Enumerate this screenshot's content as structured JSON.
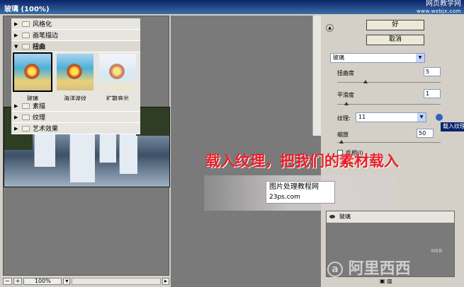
{
  "window": {
    "title": "玻璃  (100%)"
  },
  "watermark": {
    "site_name": "网页教学网",
    "site_url": "www.webjx.com"
  },
  "preview": {
    "zoom_minus": "−",
    "zoom_plus": "+",
    "zoom_value": "100%",
    "scroll_right": "▸"
  },
  "gallery": {
    "folders": [
      {
        "label": "风格化"
      },
      {
        "label": "画笔描边"
      },
      {
        "label": "扭曲"
      },
      {
        "label": "素描"
      },
      {
        "label": "纹理"
      },
      {
        "label": "艺术效果"
      }
    ],
    "thumbnails": [
      {
        "label": "玻璃"
      },
      {
        "label": "海洋波纹"
      },
      {
        "label": "扩散亮光"
      }
    ]
  },
  "buttons": {
    "ok": "好",
    "cancel": "取消"
  },
  "params": {
    "filter_select": "玻璃",
    "distortion_label": "扭曲度",
    "distortion_value": "5",
    "smoothness_label": "平滑度",
    "smoothness_value": "1",
    "texture_label": "纹理:",
    "texture_value": "11",
    "scaling_label": "缩放",
    "scaling_value": "50",
    "invert_label": "反相(I)",
    "load_texture_tooltip": "载入纹理"
  },
  "sliders": {
    "distortion_fraction": 0.25,
    "smoothness_fraction": 0.07,
    "scaling_fraction": 0.02
  },
  "layers": {
    "item_label": "玻璃"
  },
  "annotation": {
    "headline": "载入纹理，把我们的素材载入",
    "stamp_title": "图片处理",
    "stamp_suffix": "教程网",
    "stamp_url": "23ps.com"
  },
  "brand": {
    "logo": "阿里西西",
    "web": "WEB"
  }
}
